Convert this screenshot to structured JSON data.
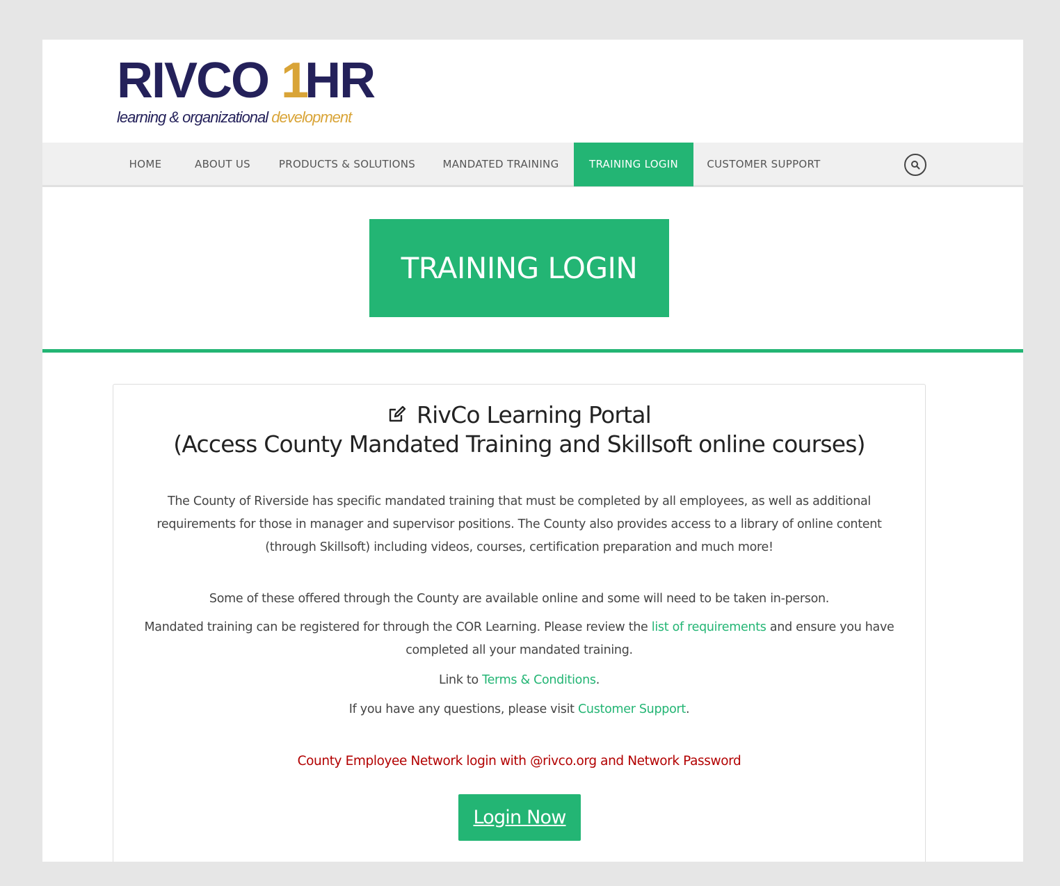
{
  "logo": {
    "brand_prefix": "RIVCO ",
    "brand_one": "1",
    "brand_suffix": "HR",
    "tagline_main": "learning & organizational ",
    "tagline_accent": "development"
  },
  "nav": {
    "items": [
      {
        "label": "HOME"
      },
      {
        "label": "ABOUT US"
      },
      {
        "label": "PRODUCTS & SOLUTIONS"
      },
      {
        "label": "MANDATED TRAINING"
      },
      {
        "label": "TRAINING LOGIN",
        "active": true
      },
      {
        "label": "CUSTOMER SUPPORT"
      }
    ],
    "search_icon": "search-icon"
  },
  "hero": {
    "title": "TRAINING LOGIN"
  },
  "card": {
    "icon": "edit-icon",
    "title_line1": "RivCo Learning Portal",
    "title_line2": "(Access County Mandated Training and Skillsoft online courses)",
    "intro": "The County of Riverside has specific mandated training that must be completed by all employees, as well as additional requirements for those in manager and supervisor positions. The County also provides access to a library of online content (through Skillsoft) including videos, courses, certification preparation and much more!",
    "offered_text": "Some of these offered through the County are available online and some will need to be taken in-person.",
    "mandated_pre": "Mandated training can be registered for through the COR Learning. Please review the ",
    "mandated_link": "list of requirements",
    "mandated_post": " and ensure you have completed all your mandated training.",
    "terms_pre": "Link to ",
    "terms_link": "Terms & Conditions",
    "terms_post": ".",
    "questions_pre": "If you have any questions, please visit ",
    "questions_link": "Customer Support",
    "questions_post": ".",
    "network_note": "County Employee Network login with @rivco.org and Network Password",
    "login_button": "Login Now"
  },
  "colors": {
    "brand_navy": "#24215a",
    "brand_gold": "#d9a437",
    "accent_green": "#23b574",
    "note_red": "#b20000"
  }
}
